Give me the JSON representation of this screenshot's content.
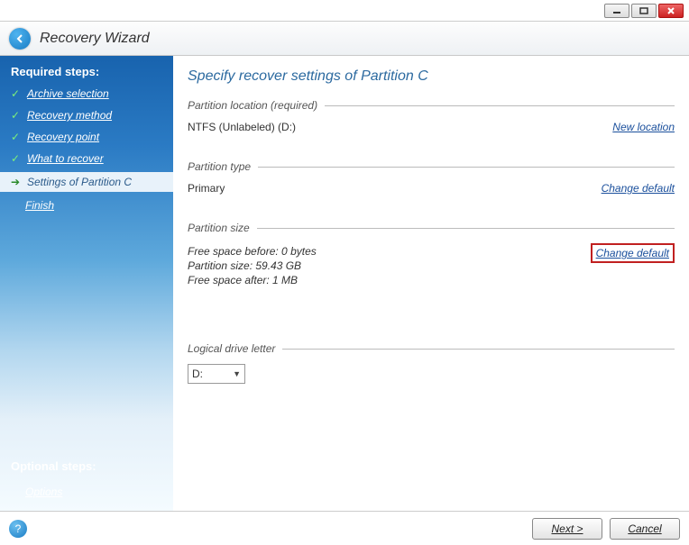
{
  "window": {
    "title": "Recovery Wizard"
  },
  "sidebar": {
    "required_heading": "Required steps:",
    "steps": [
      {
        "label": "Archive selection"
      },
      {
        "label": "Recovery method"
      },
      {
        "label": "Recovery point"
      },
      {
        "label": "What to recover"
      },
      {
        "label": "Settings of Partition C"
      },
      {
        "label": "Finish"
      }
    ],
    "optional_heading": "Optional steps:",
    "optional_link": "Options"
  },
  "main": {
    "title": "Specify recover settings of Partition C",
    "location": {
      "heading": "Partition location (required)",
      "value": "NTFS (Unlabeled) (D:)",
      "link": "New location"
    },
    "type": {
      "heading": "Partition type",
      "value": "Primary",
      "link": "Change default"
    },
    "size": {
      "heading": "Partition size",
      "free_before": "Free space before: 0 bytes",
      "partition_size": "Partition size: 59.43 GB",
      "free_after": "Free space after: 1 MB",
      "link": "Change default"
    },
    "drive": {
      "heading": "Logical drive letter",
      "value": "D:"
    }
  },
  "footer": {
    "next": "Next >",
    "cancel": "Cancel"
  }
}
